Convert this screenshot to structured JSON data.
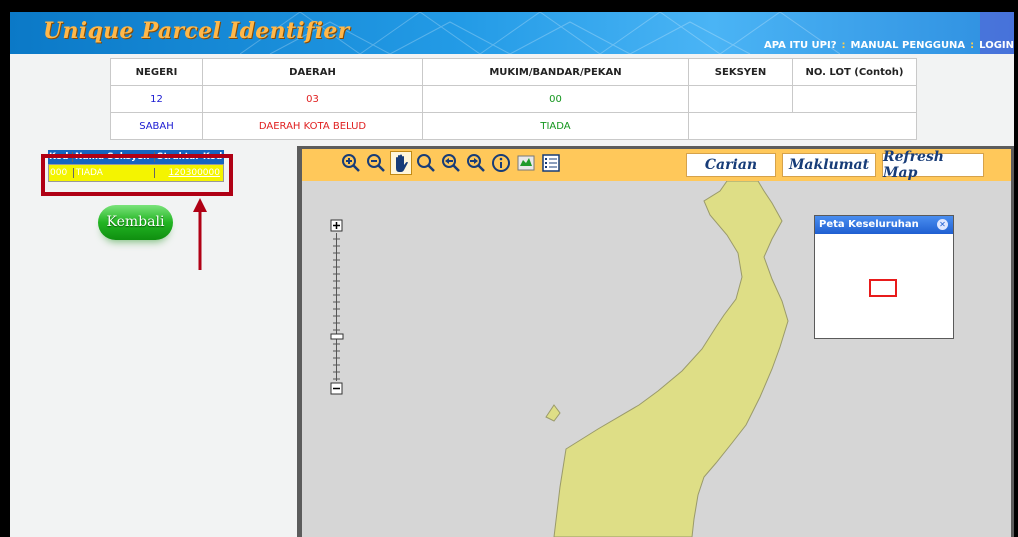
{
  "banner": {
    "title": "Unique Parcel Identifier",
    "nav": [
      "APA ITU UPI?",
      "MANUAL PENGGUNA",
      "LOGIN"
    ]
  },
  "info_table": {
    "headers": [
      "NEGERI",
      "DAERAH",
      "MUKIM/BANDAR/PEKAN",
      "SEKSYEN",
      "NO. LOT (Contoh)"
    ],
    "codes": [
      "12",
      "03",
      "00",
      "",
      ""
    ],
    "names": [
      "SABAH",
      "DAERAH KOTA BELUD",
      "TIADA",
      ""
    ]
  },
  "grid": {
    "headers": [
      "Kod",
      "Nama Seksyen",
      "Struktur Kod"
    ],
    "rows": [
      {
        "kod": "000",
        "nama": "TIADA",
        "struktur": "120300000"
      }
    ]
  },
  "kembali_label": "Kembali",
  "map": {
    "tools": [
      "zoom-in",
      "zoom-out",
      "pan",
      "zoom-extent",
      "back",
      "forward",
      "info",
      "layers",
      "legend"
    ],
    "active_tool": "pan",
    "buttons": [
      "Carian",
      "Maklumat",
      "Refresh Map"
    ],
    "overview_title": "Peta Keseluruhan"
  },
  "colors": {
    "banner": "#1a8fe0",
    "title": "#ffb84a",
    "toolbar": "#ffc85a",
    "land": "#dede86",
    "water": "#d6d6d6",
    "highlight": "#b00014",
    "grid_row": "#f4f400",
    "grid_head": "#1565c0"
  }
}
